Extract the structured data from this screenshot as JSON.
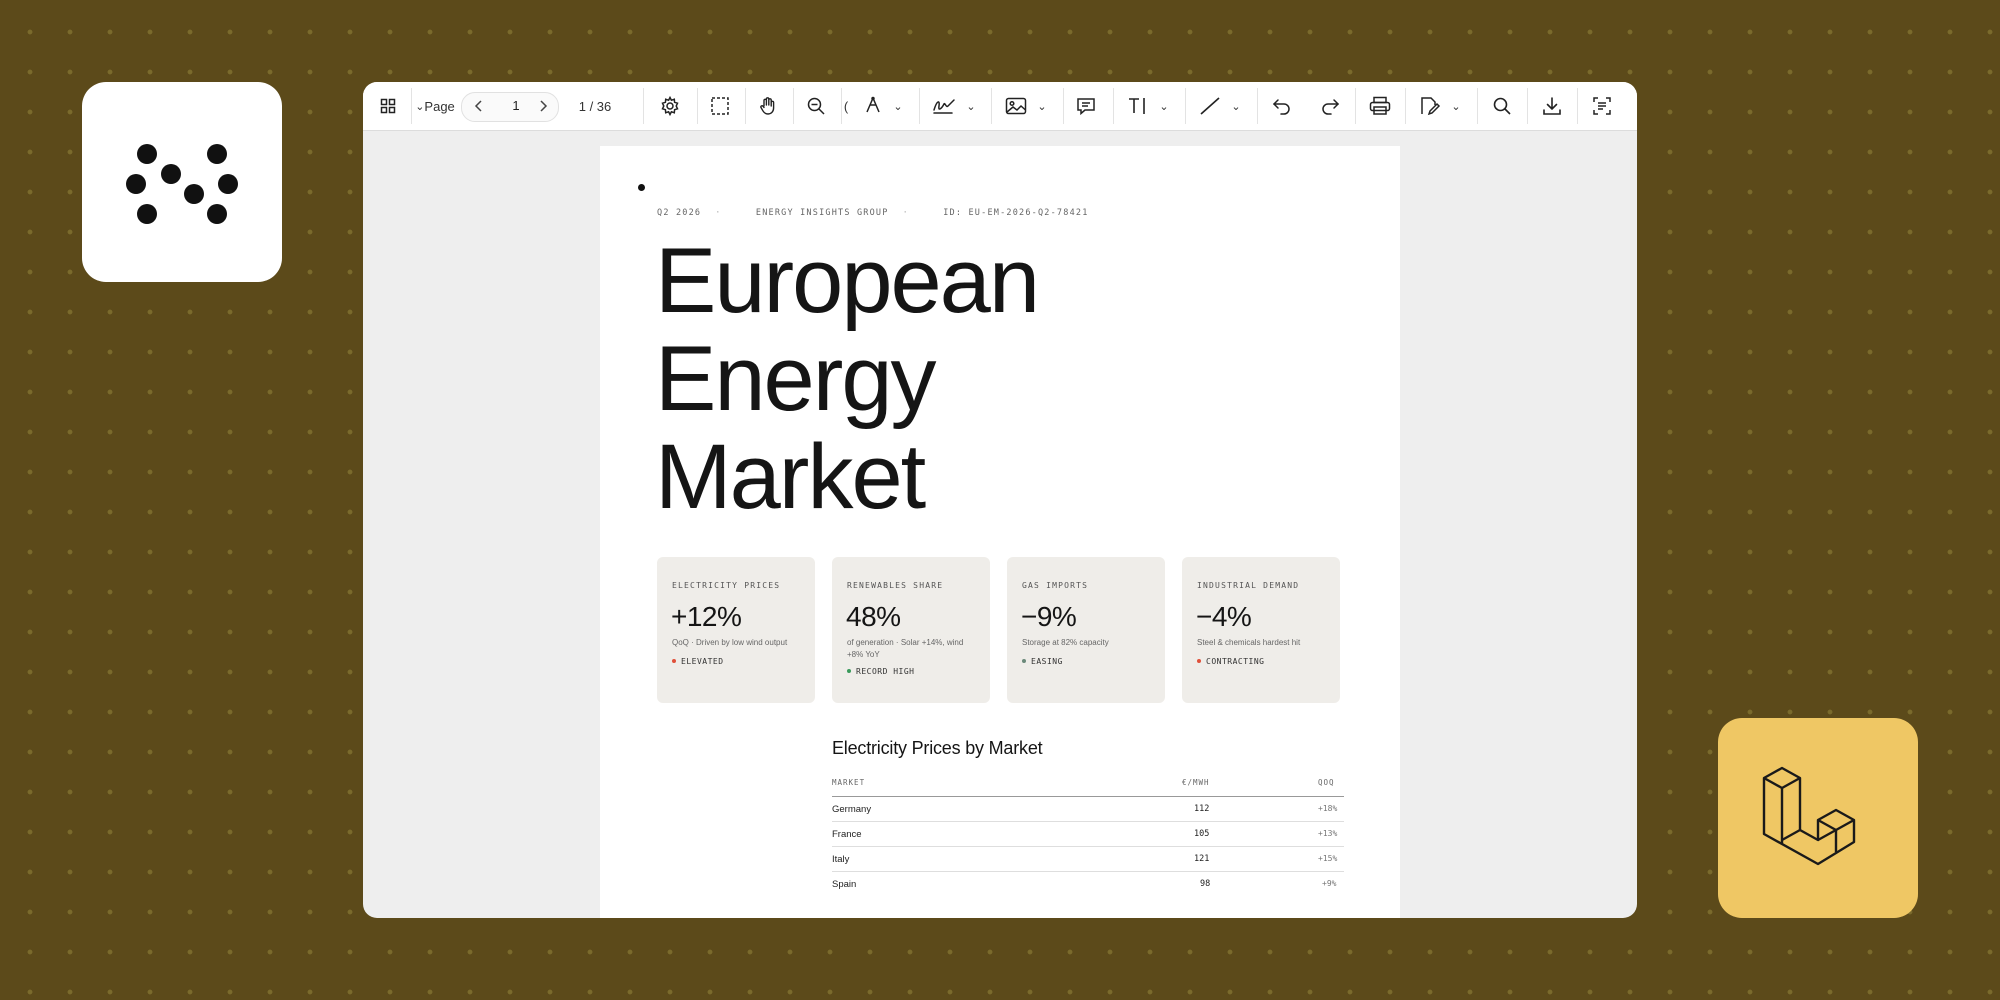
{
  "toolbar": {
    "page_label": "Page",
    "page_input_value": "1",
    "page_count": "1 / 36",
    "icons": [
      "thumbnails-icon",
      "settings-icon",
      "marquee-select-icon",
      "pan-hand-icon",
      "zoom-out-icon",
      "pen-icon",
      "signature-icon",
      "image-icon",
      "comment-icon",
      "text-icon",
      "line-icon",
      "undo-icon",
      "redo-icon",
      "print-icon",
      "edit-icon",
      "search-icon",
      "download-icon",
      "form-fields-icon"
    ]
  },
  "document": {
    "meta": [
      "Q2 2026",
      "ENERGY INSIGHTS GROUP",
      "ID: EU-EM-2026-Q2-78421"
    ],
    "title_lines": [
      "European",
      "Energy",
      "Market"
    ],
    "cards": [
      {
        "label": "ELECTRICITY PRICES",
        "value": "+12%",
        "desc": "QoQ · Driven by low wind output",
        "status": "ELEVATED",
        "status_color": "#e0503a"
      },
      {
        "label": "RENEWABLES SHARE",
        "value": "48%",
        "desc": "of generation · Solar +14%, wind +8% YoY",
        "status": "RECORD HIGH",
        "status_color": "#3a9a5b"
      },
      {
        "label": "GAS IMPORTS",
        "value": "−9%",
        "desc": "Storage at 82% capacity",
        "status": "EASING",
        "status_color": "#6b8a7a"
      },
      {
        "label": "INDUSTRIAL DEMAND",
        "value": "−4%",
        "desc": "Steel & chemicals hardest hit",
        "status": "CONTRACTING",
        "status_color": "#e0503a"
      }
    ],
    "table": {
      "title": "Electricity Prices by Market",
      "headers": [
        "MARKET",
        "€/MWH",
        "QOQ"
      ],
      "rows": [
        {
          "market": "Germany",
          "price": "112",
          "qoq": "+18%"
        },
        {
          "market": "France",
          "price": "105",
          "qoq": "+13%"
        },
        {
          "market": "Italy",
          "price": "121",
          "qoq": "+15%"
        },
        {
          "market": "Spain",
          "price": "98",
          "qoq": "+9%"
        }
      ]
    }
  },
  "colors": {
    "background": "#5c4a1a",
    "laravel_tile": "#efc764",
    "card_bg": "#efede9"
  }
}
